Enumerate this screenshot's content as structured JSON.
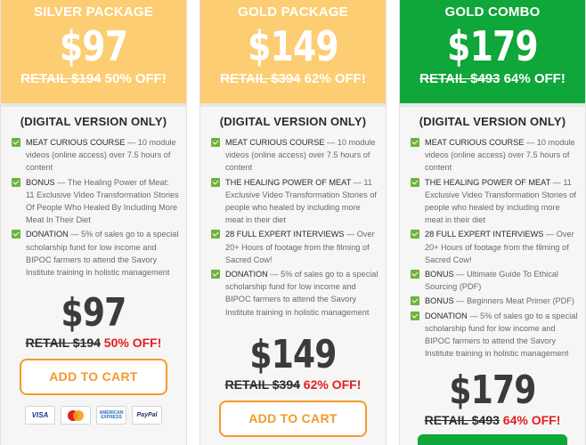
{
  "colors": {
    "silver_header": "#fccd72",
    "gold_header": "#fccd72",
    "combo_header": "#0fa63a",
    "check": "#6fb23b",
    "off_red": "#e21f1f",
    "cart_orange": "#f39a2a"
  },
  "packages": [
    {
      "title": "SILVER PACKAGE",
      "price": "$97",
      "retail": "RETAIL $194",
      "discount": "50% OFF!",
      "digital_note": "(DIGITAL VERSION ONLY)",
      "features": [
        {
          "name": "MEAT CURIOUS COURSE",
          "desc": " — 10 module videos (online access) over 7.5 hours of content"
        },
        {
          "name": "BONUS",
          "desc": " — The Healing Power of Meat: 11 Exclusive Video Transformation Stories Of People Who Healed By Including More Meat In Their Diet"
        },
        {
          "name": "DONATION",
          "desc": " — 5% of sales go to a special scholarship fund for low income and BIPOC farmers to attend the Savory Institute training in holistic management"
        }
      ],
      "bottom_price": "$97",
      "bottom_retail": "RETAIL $194",
      "bottom_discount": "50% OFF!",
      "cart_label": "ADD TO CART",
      "payment_icons": [
        "visa-icon",
        "mastercard-icon",
        "american-express-icon",
        "paypal-icon"
      ],
      "payment_labels": {
        "visa": "VISA",
        "amex": "AMERICAN EXPRESS",
        "paypal": "PayPal"
      }
    },
    {
      "title": "GOLD PACKAGE",
      "price": "$149",
      "retail": "RETAIL $394",
      "discount": "62% OFF!",
      "digital_note": "(DIGITAL VERSION ONLY)",
      "features": [
        {
          "name": "MEAT CURIOUS COURSE",
          "desc": " — 10 module videos (online access) over 7.5 hours of content"
        },
        {
          "name": "THE HEALING POWER OF MEAT",
          "desc": " — 11 Exclusive Video Transformation Stories of people who healed by including more meat in their diet"
        },
        {
          "name": "28 FULL EXPERT INTERVIEWS",
          "desc": " — Over 20+ Hours of footage from the filming of Sacred Cow!"
        },
        {
          "name": "DONATION",
          "desc": " — 5% of sales go to a special scholarship fund for low income and BIPOC farmers to attend the Savory Institute training in holistic management"
        }
      ],
      "bottom_price": "$149",
      "bottom_retail": "RETAIL $394",
      "bottom_discount": "62% OFF!",
      "cart_label": "ADD TO CART"
    },
    {
      "title": "GOLD COMBO",
      "price": "$179",
      "retail": "RETAIL $493",
      "discount": "64% OFF!",
      "digital_note": "(DIGITAL VERSION ONLY)",
      "features": [
        {
          "name": "MEAT CURIOUS COURSE",
          "desc": " — 10 module videos (online access) over 7.5 hours of content"
        },
        {
          "name": "THE HEALING POWER OF MEAT",
          "desc": " — 11 Exclusive Video Transformation Stories of people who healed by including more meat in their diet"
        },
        {
          "name": "28 FULL EXPERT INTERVIEWS",
          "desc": " — Over 20+ Hours of footage from the filming of Sacred Cow!"
        },
        {
          "name": "BONUS",
          "desc": " — Ultimate Guide To Ethical Sourcing (PDF)"
        },
        {
          "name": "BONUS",
          "desc": " — Beginners Meat Primer (PDF)"
        },
        {
          "name": "DONATION",
          "desc": " — 5% of sales go to a special scholarship fund for low income and BIPOC farmers to attend the Savory Institute training in holistic management"
        }
      ],
      "bottom_price": "$179",
      "bottom_retail": "RETAIL $493",
      "bottom_discount": "64% OFF!"
    }
  ]
}
